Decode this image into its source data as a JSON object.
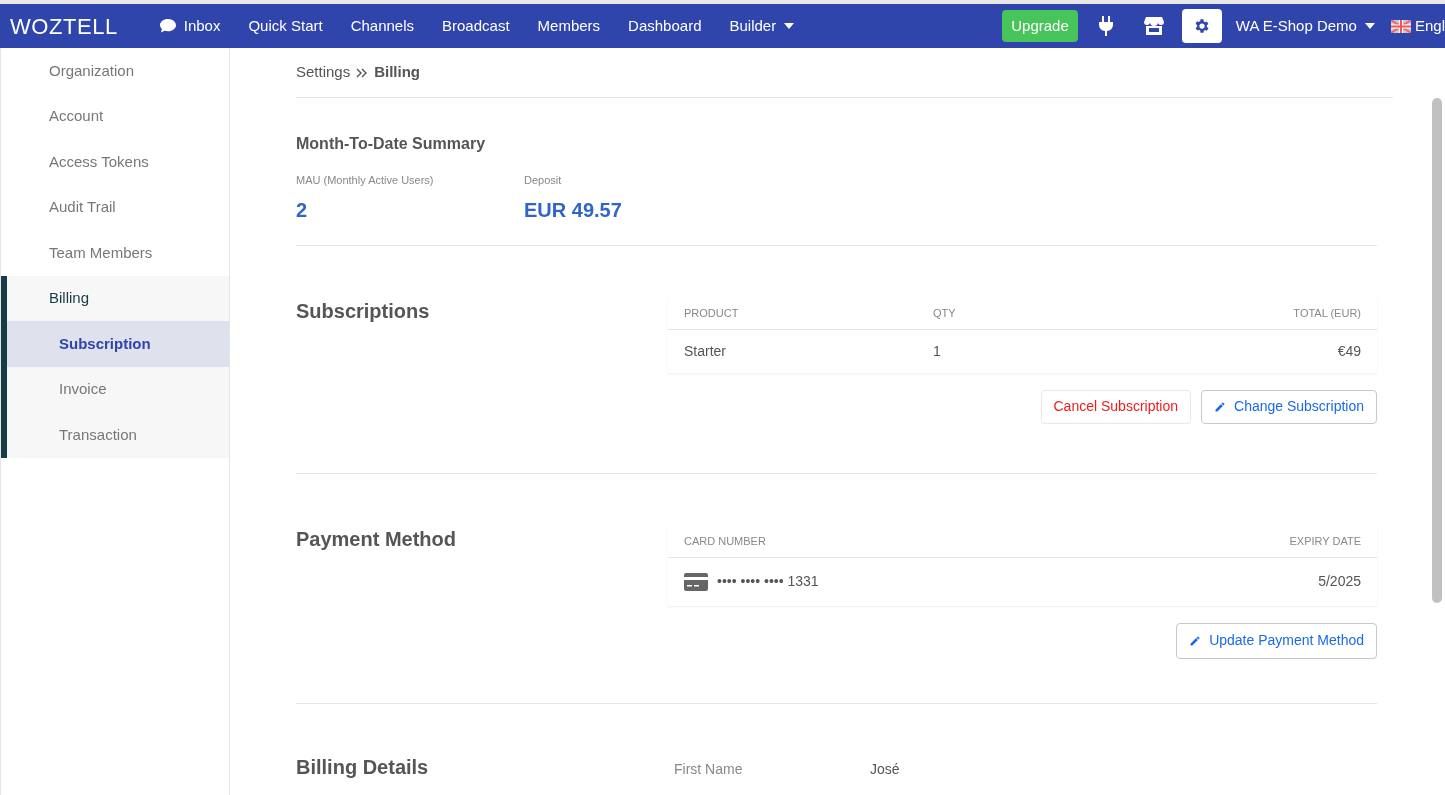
{
  "navbar": {
    "logo": "WOZTELL",
    "items": [
      {
        "label": "Inbox",
        "kind": "chat"
      },
      {
        "label": "Quick Start",
        "kind": "plain"
      },
      {
        "label": "Channels",
        "kind": "plain"
      },
      {
        "label": "Broadcast",
        "kind": "plain"
      },
      {
        "label": "Members",
        "kind": "plain"
      },
      {
        "label": "Dashboard",
        "kind": "plain"
      },
      {
        "label": "Builder",
        "kind": "dropdown"
      }
    ],
    "upgrade": "Upgrade",
    "icons": [
      {
        "kind": "plug",
        "selected": false
      },
      {
        "kind": "store",
        "selected": false
      },
      {
        "kind": "gear",
        "selected": true
      }
    ],
    "workspace": "WA E-Shop Demo",
    "language": "Engl"
  },
  "sidebar": {
    "items": [
      {
        "label": "Organization",
        "selected": false
      },
      {
        "label": "Account",
        "selected": false
      },
      {
        "label": "Access Tokens",
        "selected": false
      },
      {
        "label": "Audit Trail",
        "selected": false
      },
      {
        "label": "Team Members",
        "selected": false
      },
      {
        "label": "Billing",
        "selected": true,
        "expanded": true,
        "children": [
          {
            "label": "Subscription",
            "selected": true
          },
          {
            "label": "Invoice",
            "selected": false
          },
          {
            "label": "Transaction",
            "selected": false
          }
        ]
      }
    ]
  },
  "breadcrumb": [
    "Settings",
    "Billing"
  ],
  "summary": {
    "title": "Month-To-Date Summary",
    "stats": [
      {
        "label": "MAU (Monthly Active Users)",
        "value": "2"
      },
      {
        "label": "Deposit",
        "value": "EUR 49.57"
      }
    ]
  },
  "subscriptions": {
    "title": "Subscriptions",
    "columns": [
      "PRODUCT",
      "QTY",
      "TOTAL (EUR)"
    ],
    "rows": [
      [
        "Starter",
        "1",
        "€49"
      ]
    ],
    "buttons": [
      {
        "label": "Cancel Subscription",
        "kind": "danger"
      },
      {
        "label": "Change Subscription",
        "kind": "edit"
      }
    ]
  },
  "payment_method": {
    "title": "Payment Method",
    "columns": [
      "CARD NUMBER",
      "EXPIRY DATE"
    ],
    "rows": [
      [
        "•••• •••• •••• 1331",
        "5/2025"
      ]
    ],
    "buttons": [
      {
        "label": "Update Payment Method",
        "kind": "edit"
      }
    ]
  },
  "billing_details": {
    "title": "Billing Details",
    "fields": [
      {
        "label": "First Name",
        "value": "José"
      }
    ]
  }
}
